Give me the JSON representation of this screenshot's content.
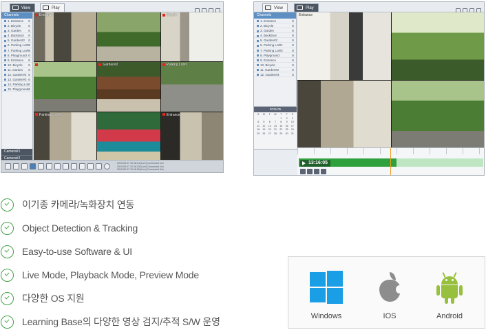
{
  "live_window": {
    "tabs": [
      {
        "label": "View"
      },
      {
        "label": "Play"
      }
    ],
    "sidebar_header": "Channels",
    "channels": [
      "1. Entrance",
      "2. Bicycle",
      "3. Garden",
      "4. Backdoor",
      "5. Garden#2",
      "6. Parking Lot#1",
      "7. Parking Lot#2",
      "8. Playground",
      "9. Entrance",
      "10. Bicycle",
      "11. Garden",
      "12. Garden#2",
      "13. Garden#3",
      "14. Parking Lot",
      "15. Playground"
    ],
    "sidebar_footer": [
      "Camera#1",
      "Camera#2"
    ],
    "cameras": [
      {
        "label": "Entrance"
      },
      {
        "label": ""
      },
      {
        "label": "Bicycle"
      },
      {
        "label": ""
      },
      {
        "label": "Garden#2"
      },
      {
        "label": "Parking Lot#1"
      },
      {
        "label": "Parking Lot#2"
      },
      {
        "label": ""
      },
      {
        "label": "Entrance"
      }
    ],
    "log_lines": [
      "2015.05.07 10:18:24 [Live] Connected 1ch",
      "2015.05.07 10:18:25 [Live] Connected 2ch",
      "2015.05.07 10:18:26 [Live] Connected 3ch"
    ]
  },
  "playback_window": {
    "tabs": [
      {
        "label": "View"
      },
      {
        "label": "Play"
      }
    ],
    "sidebar_header": "Channels",
    "channels": [
      "1. Entrance",
      "2. Bicycle",
      "3. Garden",
      "4. Backdoor",
      "5. Garden#2",
      "6. Parking Lot#1",
      "7. Parking Lot#2",
      "8. Playground",
      "9. Entrance",
      "10. Bicycle",
      "11. Garden#2",
      "12. Garden#3"
    ],
    "calendar_title": "2015.05",
    "calendar_days": [
      "S",
      "M",
      "T",
      "W",
      "T",
      "F",
      "S",
      "",
      "",
      "",
      "",
      "1",
      "2",
      "3",
      "4",
      "5",
      "6",
      "7",
      "8",
      "9",
      "10",
      "11",
      "12",
      "13",
      "14",
      "15",
      "16",
      "17",
      "18",
      "19",
      "20",
      "21",
      "22",
      "23",
      "24",
      "25",
      "26",
      "27",
      "28",
      "29",
      "30",
      "31"
    ],
    "cameras": [
      {
        "label": "Entrance"
      },
      {
        "label": ""
      },
      {
        "label": ""
      },
      {
        "label": ""
      }
    ],
    "playback_time": "13:16:05",
    "playback_progress": 0.53
  },
  "features": [
    "이기종 카메라/녹화장치 연동",
    "Object Detection & Tracking",
    "Easy-to-use Software & UI",
    "Live Mode, Playback Mode, Preview Mode",
    "다양한 OS 지원",
    "Learning Base의 다양한 영상 검지/추적 S/W 운영"
  ],
  "platforms": [
    {
      "name": "Windows",
      "icon": "windows-logo-icon",
      "color": "#1a9ee5"
    },
    {
      "name": "IOS",
      "icon": "apple-logo-icon",
      "color": "#8d8d8d"
    },
    {
      "name": "Android",
      "icon": "android-logo-icon",
      "color": "#96c03d"
    }
  ],
  "colors": {
    "check": "#43a047",
    "accent": "#5d8fc3",
    "timeline_fill": "#2fa13c",
    "record_dot": "#e3261f"
  }
}
